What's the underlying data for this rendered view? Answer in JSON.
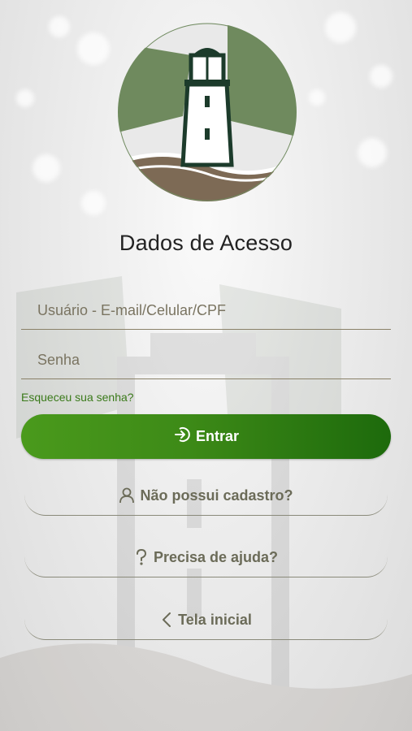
{
  "page": {
    "title": "Dados de Acesso"
  },
  "form": {
    "username_placeholder": "Usuário - E-mail/Celular/CPF",
    "username_value": "",
    "password_placeholder": "Senha",
    "password_value": "",
    "forgot_label": "Esqueceu sua senha?",
    "submit_label": "Entrar"
  },
  "links": {
    "register_label": "Não possui cadastro?",
    "help_label": "Precisa de ajuda?",
    "home_label": "Tela inicial"
  },
  "icons": {
    "logo": "lighthouse-logo",
    "submit": "login-arrow-icon",
    "register": "user-icon",
    "help": "question-icon",
    "home": "chevron-left-icon"
  },
  "colors": {
    "primary_start": "#4a9a1c",
    "primary_end": "#1d6a0c",
    "logo_green": "#6f8a5e",
    "logo_brown": "#7d6a55",
    "link_text": "#6b6b58"
  }
}
